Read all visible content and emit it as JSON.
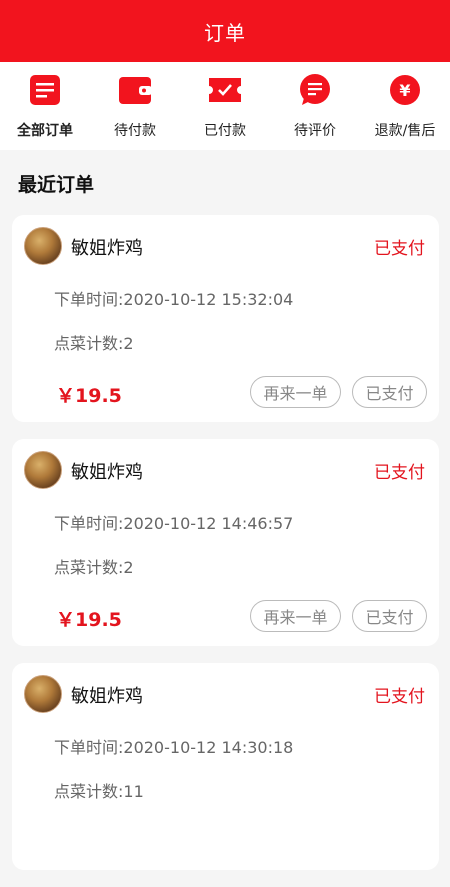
{
  "header": {
    "title": "订单"
  },
  "tabs": [
    {
      "label": "全部订单",
      "icon": "list-icon"
    },
    {
      "label": "待付款",
      "icon": "wallet-icon"
    },
    {
      "label": "已付款",
      "icon": "ticket-check-icon"
    },
    {
      "label": "待评价",
      "icon": "chat-icon"
    },
    {
      "label": "退款/售后",
      "icon": "yen-icon"
    }
  ],
  "section_title": "最近订单",
  "orders": [
    {
      "shop": "敏姐炸鸡",
      "status": "已支付",
      "time": "下单时间:2020-10-12 15:32:04",
      "count": "点菜计数:2",
      "price": "￥19.5",
      "reorder_label": "再来一单",
      "paid_label": "已支付"
    },
    {
      "shop": "敏姐炸鸡",
      "status": "已支付",
      "time": "下单时间:2020-10-12 14:46:57",
      "count": "点菜计数:2",
      "price": "￥19.5",
      "reorder_label": "再来一单",
      "paid_label": "已支付"
    },
    {
      "shop": "敏姐炸鸡",
      "status": "已支付",
      "time": "下单时间:2020-10-12 14:30:18",
      "count": "点菜计数:11",
      "price": "",
      "reorder_label": "",
      "paid_label": ""
    }
  ],
  "colors": {
    "primary": "#f2141e",
    "price": "#e3141e"
  }
}
